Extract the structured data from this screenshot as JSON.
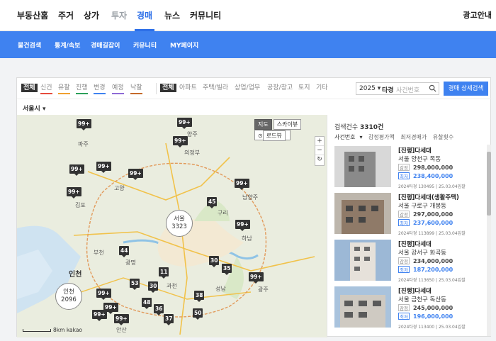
{
  "topnav": {
    "items": [
      "부동산홈",
      "주거",
      "상가",
      "투자",
      "경매",
      "뉴스",
      "커뮤니티"
    ],
    "active": "경매",
    "ad": "광고안내"
  },
  "subnav": {
    "items": [
      "물건검색",
      "통계/속보",
      "경매길잡이",
      "커뮤니티",
      "MY페이지"
    ]
  },
  "filters": {
    "status": [
      {
        "label": "전체",
        "bar": ""
      },
      {
        "label": "신건",
        "bar": "#e64b3c"
      },
      {
        "label": "유찰",
        "bar": "#f0a030"
      },
      {
        "label": "진행",
        "bar": "#2ca05a"
      },
      {
        "label": "변경",
        "bar": "#3f82f0"
      },
      {
        "label": "예정",
        "bar": "#8e6bd6"
      },
      {
        "label": "낙찰",
        "bar": "#c56a2a"
      }
    ],
    "types": [
      "전체",
      "아파트",
      "주택/빌라",
      "상업/업무",
      "공장/창고",
      "토지",
      "기타"
    ],
    "year": "2025",
    "court": "타경",
    "case_placeholder": "사건번호",
    "detail_button": "경매 상세검색",
    "region": "서울시"
  },
  "map": {
    "buttons": [
      "지도",
      "스카이뷰",
      "로드뷰"
    ],
    "zoom": [
      "+",
      "−"
    ],
    "clusters": [
      "99+",
      "99+",
      "99+",
      "99+",
      "99+",
      "99+",
      "99+",
      "99+",
      "45",
      "99+",
      "44",
      "30",
      "35",
      "99+",
      "11",
      "53",
      "30",
      "99+",
      "48",
      "38",
      "36",
      "99+",
      "50",
      "37",
      "99+",
      "99+"
    ],
    "big_circles": [
      {
        "name": "서울",
        "count": "3323"
      },
      {
        "name": "인천",
        "count": "2096"
      }
    ],
    "places": [
      "양주",
      "의정부",
      "고양",
      "남양주",
      "구리",
      "김포",
      "부천",
      "인천",
      "광명",
      "과천",
      "성남",
      "하남",
      "광주",
      "안산",
      "파주"
    ],
    "scale": "8km",
    "brand": "kakao"
  },
  "list": {
    "count_label": "검색건수",
    "count_value": "3310건",
    "sorts": [
      "사건번호",
      "감정평가액",
      "최저경매가",
      "유찰횟수"
    ],
    "items": [
      {
        "title": "[진행]다세대",
        "addr": "서울 양천구 목동",
        "appraisal": "298,000,000",
        "minimum": "238,400,000",
        "meta": "2024타경 130495 | 25.03.04입찰"
      },
      {
        "title": "[진행]다세대(생활주택)",
        "addr": "서울 구로구 개봉동",
        "appraisal": "297,000,000",
        "minimum": "237,600,000",
        "meta": "2024타경 113899 | 25.03.04입찰"
      },
      {
        "title": "[진행]다세대",
        "addr": "서울 강서구 화곡동",
        "appraisal": "234,000,000",
        "minimum": "187,200,000",
        "meta": "2024타경 113650 | 25.03.04입찰"
      },
      {
        "title": "[진행]다세대",
        "addr": "서울 금천구 독산동",
        "appraisal": "245,000,000",
        "minimum": "196,000,000",
        "meta": "2024타경 113400 | 25.03.04입찰"
      }
    ],
    "tag_appraisal": "감정",
    "tag_min": "최저"
  },
  "colors": {
    "accent": "#3f82f0",
    "nav_active": "#2d6fe8",
    "cluster": "#333333"
  }
}
